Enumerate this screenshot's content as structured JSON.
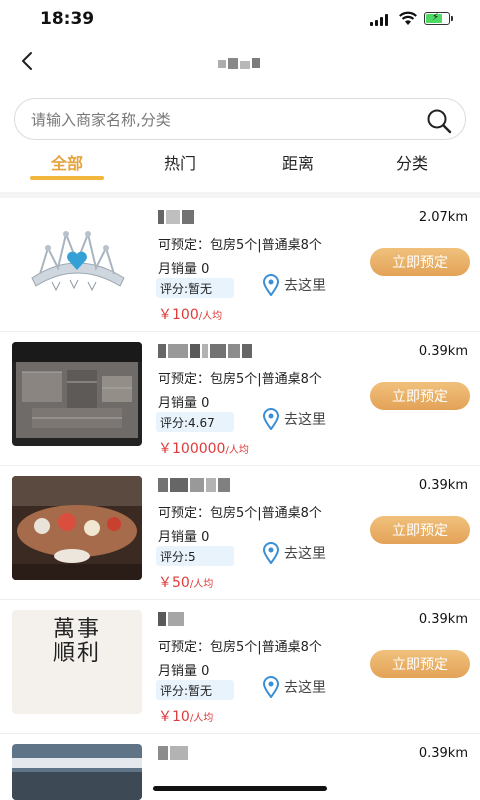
{
  "status": {
    "time": "18:39"
  },
  "search": {
    "placeholder": "请输入商家名称,分类"
  },
  "tabs": [
    {
      "label": "全部",
      "active": true
    },
    {
      "label": "热门"
    },
    {
      "label": "距离"
    },
    {
      "label": "分类"
    }
  ],
  "shops": [
    {
      "distance": "2.07km",
      "booking": "可预定：包房5个|普通桌8个",
      "sales": "月销量 0",
      "rating": "评分:暂无",
      "nav_label": "去这里",
      "price": "￥100",
      "price_unit": "/人均",
      "book_label": "立即预定",
      "thumb": "crown-icon"
    },
    {
      "distance": "0.39km",
      "booking": "可预定：包房5个|普通桌8个",
      "sales": "月销量 0",
      "rating": "评分:4.67",
      "nav_label": "去这里",
      "price": "￥100000",
      "price_unit": "/人均",
      "book_label": "立即预定",
      "thumb": "floorplan-photo"
    },
    {
      "distance": "0.39km",
      "booking": "可预定：包房5个|普通桌8个",
      "sales": "月销量 0",
      "rating": "评分:5",
      "nav_label": "去这里",
      "price": "￥50",
      "price_unit": "/人均",
      "book_label": "立即预定",
      "thumb": "banquet-photo"
    },
    {
      "distance": "0.39km",
      "booking": "可预定：包房5个|普通桌8个",
      "sales": "月销量 0",
      "rating": "评分:暂无",
      "nav_label": "去这里",
      "price": "￥10",
      "price_unit": "/人均",
      "book_label": "立即预定",
      "thumb": "calligraphy-image",
      "calligraphy": "萬事順利"
    },
    {
      "distance": "0.39km",
      "thumb": "building-photo"
    }
  ],
  "colors": {
    "accent": "#f2b63c",
    "price": "#e03a3a",
    "rating_bg": "#e8f3fc",
    "book_button": "#e3a257"
  }
}
